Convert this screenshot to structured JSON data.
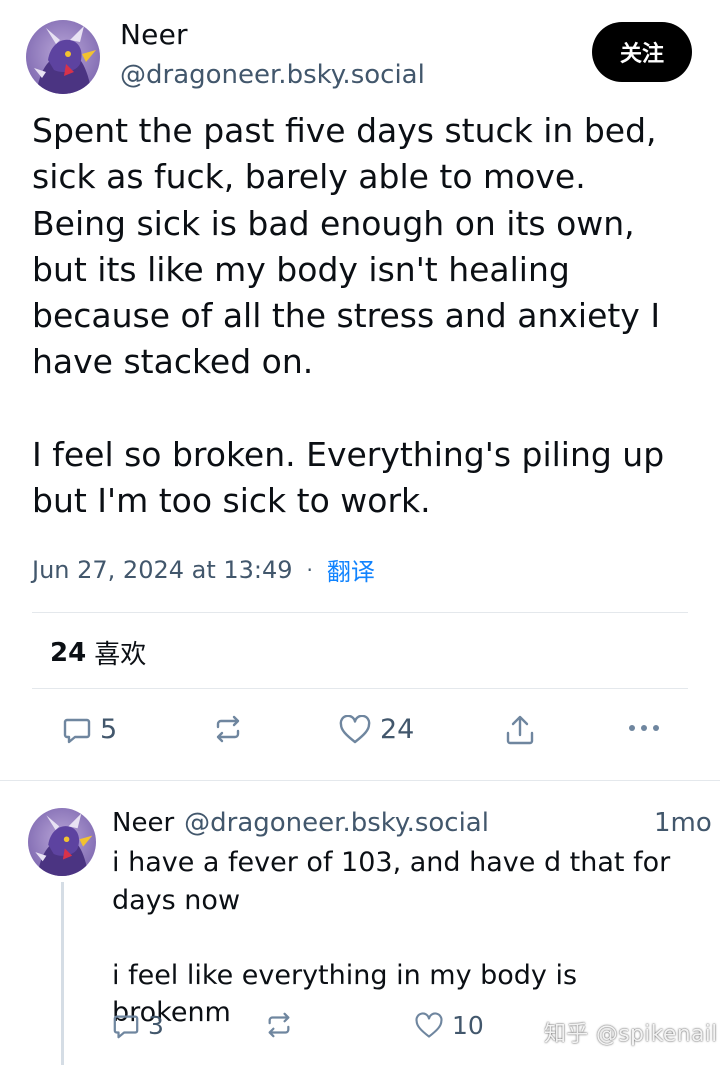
{
  "post": {
    "author_name": "Neer",
    "author_handle": "@dragoneer.bsky.social",
    "follow_label": "关注",
    "text": "Spent the past five days stuck in bed,\nsick as fuck, barely able to move.\nBeing sick is bad enough on its own,\nbut its like my body isn't healing\nbecause of all the stress and anxiety I\nhave stacked on.\n\nI feel so broken. Everything's piling up\nbut I'm too sick to work.",
    "timestamp": "Jun 27, 2024 at 13:49",
    "separator": "·",
    "translate_label": "翻译",
    "likes_count": "24",
    "likes_label": "喜欢",
    "actions": {
      "reply_count": "5",
      "like_count": "24"
    },
    "avatar_icon": "dragon-avatar-icon"
  },
  "reply": {
    "author_name": "Neer",
    "author_handle": "@dragoneer.bsky.social",
    "time": "1mo",
    "text": "i have a fever of 103, and have d that for\ndays now\n\ni feel like everything in my body is brokenm",
    "actions": {
      "reply_count": "3",
      "like_count": "10"
    }
  },
  "watermark": "知乎 @spikenail",
  "colors": {
    "text": "#0b0f14",
    "secondary": "#42576c",
    "icon": "#6f869f",
    "link": "#1083fe",
    "divider": "#e4e8ec",
    "button_bg": "#000000",
    "avatar_purple": "#6a4fa8"
  }
}
